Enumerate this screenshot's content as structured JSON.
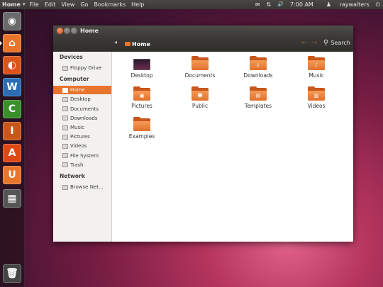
{
  "top_panel": {
    "app_name": "Home",
    "caret": "▾",
    "menu": [
      "File",
      "Edit",
      "View",
      "Go",
      "Bookmarks",
      "Help"
    ],
    "indicators": {
      "mail": "✉",
      "network": "⇅",
      "sound": "🔊",
      "time": "7:00 AM",
      "user": "raywalters",
      "power": "⏻"
    }
  },
  "launcher": {
    "items": [
      {
        "name": "dash",
        "glyph": "◉",
        "color": "#6a6a6a"
      },
      {
        "name": "home-folder",
        "glyph": "⌂",
        "color": "#e9742c"
      },
      {
        "name": "firefox",
        "glyph": "◐",
        "color": "#d8561c"
      },
      {
        "name": "writer",
        "glyph": "W",
        "color": "#2a6db5"
      },
      {
        "name": "calc",
        "glyph": "C",
        "color": "#3a8f2a"
      },
      {
        "name": "impress",
        "glyph": "I",
        "color": "#c9561b"
      },
      {
        "name": "software-center",
        "glyph": "A",
        "color": "#dd4814"
      },
      {
        "name": "ubuntu-one",
        "glyph": "U",
        "color": "#e9742c"
      },
      {
        "name": "workspaces",
        "glyph": "▦",
        "color": "#555555"
      },
      {
        "name": "trash",
        "glyph": "🗑",
        "color": "#444444"
      }
    ]
  },
  "window": {
    "title": "Home",
    "breadcrumb": "Home",
    "search_label": "Search",
    "back_icon": "←",
    "forward_icon": "→"
  },
  "sidebar": {
    "sections": [
      {
        "heading": "Devices",
        "items": [
          "Floppy Drive"
        ]
      },
      {
        "heading": "Computer",
        "items": [
          "Home",
          "Desktop",
          "Documents",
          "Downloads",
          "Music",
          "Pictures",
          "Videos",
          "File System",
          "Trash"
        ]
      },
      {
        "heading": "Network",
        "items": [
          "Browse Net..."
        ]
      }
    ],
    "active_item": "Home"
  },
  "files": [
    {
      "name": "Desktop",
      "kind": "desktop"
    },
    {
      "name": "Documents",
      "kind": "folder",
      "emblem": ""
    },
    {
      "name": "Downloads",
      "kind": "folder",
      "emblem": "↓"
    },
    {
      "name": "Music",
      "kind": "folder",
      "emblem": "♪"
    },
    {
      "name": "Pictures",
      "kind": "folder",
      "emblem": "▣"
    },
    {
      "name": "Public",
      "kind": "folder",
      "emblem": "☻"
    },
    {
      "name": "Templates",
      "kind": "folder",
      "emblem": "▤"
    },
    {
      "name": "Videos",
      "kind": "folder",
      "emblem": "▥"
    },
    {
      "name": "Examples",
      "kind": "folder",
      "emblem": ""
    }
  ],
  "colors": {
    "accent": "#e9742c",
    "panel": "#3c3b37"
  }
}
